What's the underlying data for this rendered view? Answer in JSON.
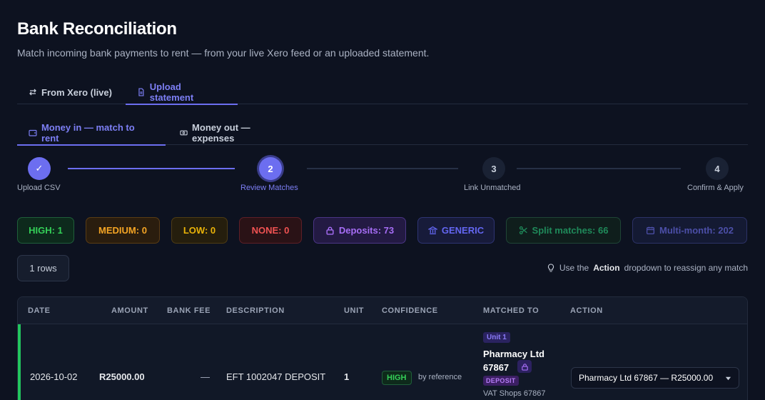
{
  "header": {
    "title": "Bank Reconciliation",
    "subtitle": "Match incoming bank payments to rent — from your live Xero feed or an uploaded statement."
  },
  "source_tabs": [
    {
      "label": "From Xero (live)",
      "icon": "arrows-swap-icon",
      "active": false
    },
    {
      "label": "Upload statement",
      "icon": "file-icon",
      "active": true
    }
  ],
  "direction_tabs": [
    {
      "label": "Money in — match to rent",
      "icon": "wallet-icon",
      "active": true
    },
    {
      "label": "Money out — expenses",
      "icon": "cash-icon",
      "active": false
    }
  ],
  "stepper": {
    "steps": [
      {
        "number": "✓",
        "label": "Upload CSV",
        "state": "done"
      },
      {
        "number": "2",
        "label": "Review Matches",
        "state": "current"
      },
      {
        "number": "3",
        "label": "Link Unmatched",
        "state": "pending"
      },
      {
        "number": "4",
        "label": "Confirm & Apply",
        "state": "pending"
      }
    ]
  },
  "filters": [
    {
      "label": "HIGH: 1",
      "color": "#34d058"
    },
    {
      "label": "MEDIUM: 0",
      "color": "#f5a524"
    },
    {
      "label": "LOW: 0",
      "color": "#eab308"
    },
    {
      "label": "NONE: 0",
      "color": "#f05252"
    },
    {
      "label": "Deposits: 73",
      "icon": "lock-icon",
      "color": "#a66df5"
    },
    {
      "label": "GENERIC",
      "icon": "bank-icon",
      "color": "#6366f1"
    },
    {
      "label": "Split matches: 66",
      "icon": "scissors-icon",
      "color": "#1f8a5a"
    },
    {
      "label": "Multi-month: 202",
      "icon": "calendar-icon",
      "color": "#4c4fa8"
    }
  ],
  "rows_button": "1 rows",
  "hint": {
    "prefix": "Use the",
    "bold": "Action",
    "suffix": "dropdown to reassign any match",
    "icon": "lightbulb-icon"
  },
  "table": {
    "columns": [
      "DATE",
      "AMOUNT",
      "BANK FEE",
      "DESCRIPTION",
      "UNIT",
      "CONFIDENCE",
      "MATCHED TO",
      "ACTION"
    ],
    "rows": [
      {
        "date": "2026-10-02",
        "amount": "R25000.00",
        "bank_fee": "—",
        "description": "EFT 1002047 DEPOSIT",
        "unit": "1",
        "confidence": "HIGH",
        "confidence_reason": "by reference",
        "matched_unit_tag": "Unit 1",
        "matched_tenant": "Pharmacy Ltd 67867",
        "deposit_tag": "DEPOSIT",
        "matched_sub": "VAT Shops 67867",
        "action_value": "Pharmacy Ltd 67867 — R25000.00"
      }
    ]
  }
}
